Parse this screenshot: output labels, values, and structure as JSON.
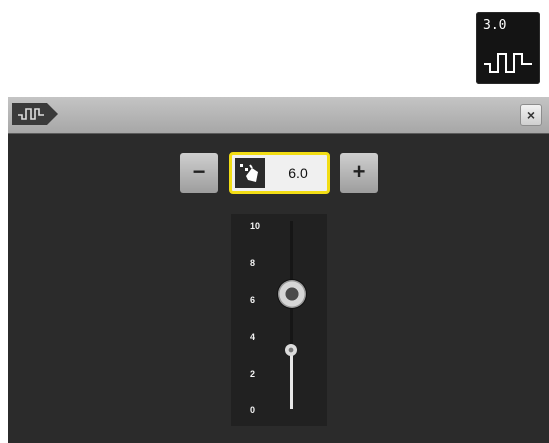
{
  "preview": {
    "value": "3.0",
    "icon": "stitch-icon"
  },
  "titlebar": {
    "tag_icon": "stitch-icon",
    "close_icon": "close-icon",
    "close_label": "×"
  },
  "stepper": {
    "minus_label": "−",
    "plus_label": "+",
    "value": "6.0",
    "value_icon": "hand-stitch-icon"
  },
  "slider": {
    "ticks": [
      "10",
      "8",
      "6",
      "4",
      "2",
      "0"
    ],
    "current_level": 6.0,
    "original_level": 3.0,
    "range": [
      0,
      10
    ]
  },
  "colors": {
    "highlight": "#f2dd15",
    "panel": "#2b2b2b"
  }
}
